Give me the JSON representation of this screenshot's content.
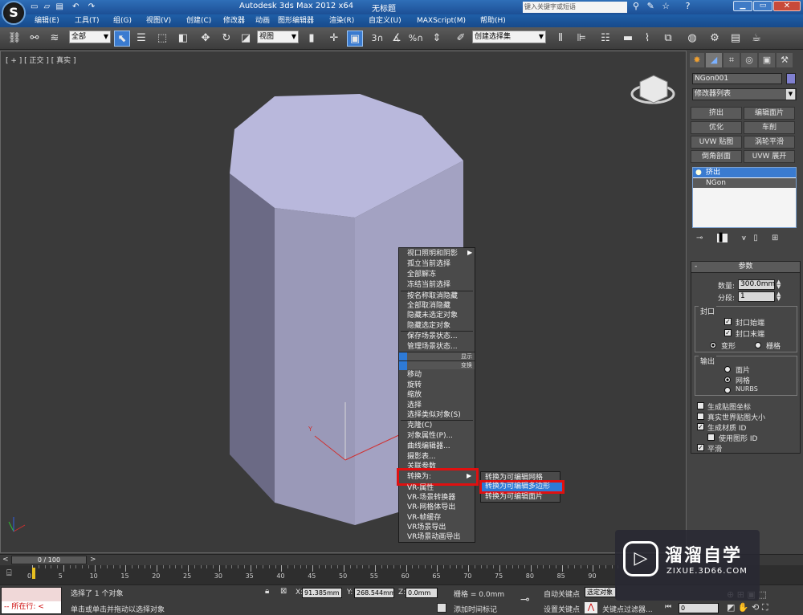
{
  "titlebar": {
    "app_title": "Autodesk 3ds Max  2012 x64",
    "doc_title": "无标题",
    "search_placeholder": "键入关键字或短语"
  },
  "menu": [
    "编辑(E)",
    "工具(T)",
    "组(G)",
    "视图(V)",
    "创建(C)",
    "修改器",
    "动画",
    "图形编辑器",
    "渲染(R)",
    "自定义(U)",
    "MAXScript(M)",
    "帮助(H)"
  ],
  "toolbar": {
    "filter_value": "全部",
    "coord_value": "视图",
    "named_sel_value": "创建选择集"
  },
  "viewport": {
    "label": "[ + ] [ 正交 ] [ 真实 ]"
  },
  "context_menu": {
    "items_top": [
      "视口照明和阴影",
      "孤立当前选择",
      "全部解冻",
      "冻结当前选择",
      "按名称取消隐藏",
      "全部取消隐藏",
      "隐藏未选定对象",
      "隐藏选定对象",
      "保存场景状态...",
      "管理场景状态..."
    ],
    "bar1_label": "显示",
    "bar2_label": "变换",
    "items_transform": [
      "移动",
      "旋转",
      "缩放",
      "选择",
      "选择类似对象(S)",
      "克隆(C)",
      "对象属性(P)...",
      "曲线编辑器...",
      "摄影表...",
      "关联参数"
    ],
    "convert_label": "转换为:",
    "items_vray": [
      "VR-属性",
      "VR-场景转换器",
      "VR-网格体导出",
      "VR-帧缓存",
      "VR场景导出",
      "VR场景动画导出"
    ]
  },
  "submenu": {
    "items": [
      "转换为可编辑网格",
      "转换为可编辑多边形",
      "转换为可编辑面片"
    ],
    "highlighted_index": 1
  },
  "right_panel": {
    "object_name": "NGon001",
    "object_color": "#8080d0",
    "modifier_list": "修改器列表",
    "mod_buttons": [
      "挤出",
      "编辑面片",
      "优化",
      "车削",
      "UVW 贴图",
      "涡轮平滑",
      "倒角剖面",
      "UVW 展开"
    ],
    "stack": [
      "挤出",
      "NGon"
    ],
    "params_title": "参数",
    "amount_label": "数量:",
    "amount_value": "300.0mm",
    "segments_label": "分段:",
    "segments_value": "1",
    "capping_title": "封口",
    "cap_start": "封口始端",
    "cap_end": "封口末端",
    "morph": "变形",
    "grid": "栅格",
    "output_title": "输出",
    "out_patch": "面片",
    "out_mesh": "网格",
    "out_nurbs": "NURBS",
    "gen_map": "生成贴图坐标",
    "real_world": "真实世界贴图大小",
    "gen_mat": "生成材质 ID",
    "use_shape": "使用图形 ID",
    "smooth": "平滑"
  },
  "timeline": {
    "frame_label": "0 / 100",
    "ticks": [
      "0",
      "5",
      "10",
      "15",
      "20",
      "25",
      "30",
      "35",
      "40",
      "45",
      "50",
      "55",
      "60",
      "65",
      "70",
      "75",
      "80",
      "85",
      "90"
    ]
  },
  "status": {
    "current_label": "所在行:",
    "selected_msg": "选择了 1 个对象",
    "prompt_msg": "单击或单击并拖动以选择对象",
    "x_label": "X:",
    "x_value": "91.385mm",
    "y_label": "Y:",
    "y_value": "268.544mm",
    "z_label": "Z:",
    "z_value": "0.0mm",
    "grid_label": "栅格 = 0.0mm",
    "add_time_tag": "添加时间标记",
    "auto_key": "自动关键点",
    "sel_obj": "选定对象",
    "set_key": "设置关键点",
    "key_filter": "关键点过滤器...",
    "frame_value": "0"
  },
  "watermark": {
    "brand": "溜溜自学",
    "url": "ZIXUE.3D66.COM"
  },
  "colors": {
    "highlight_red": "#e01010",
    "menu_blue": "#2e7ad6",
    "object_face": "#b9b8dc"
  }
}
